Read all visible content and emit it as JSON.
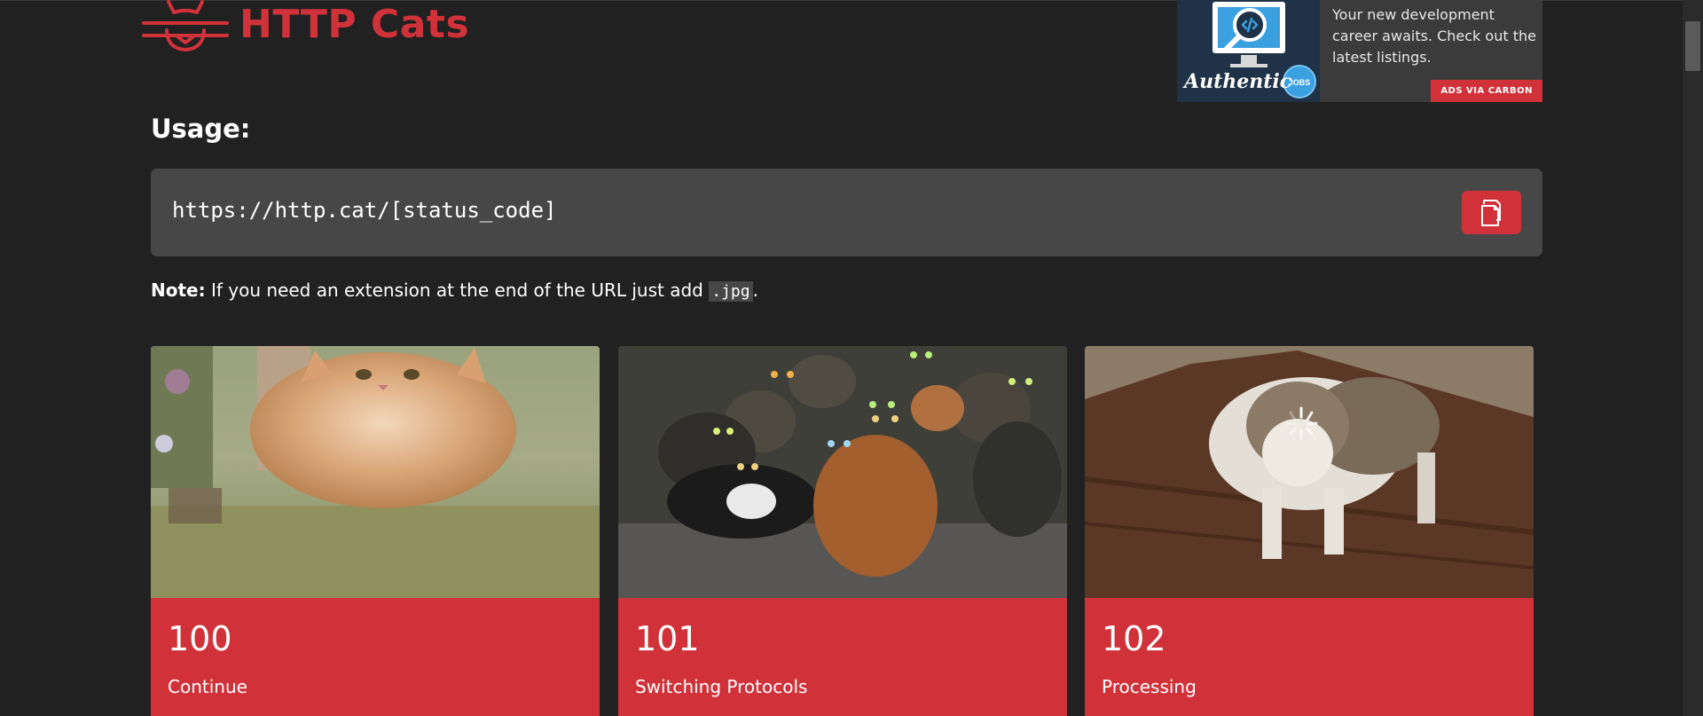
{
  "header": {
    "logo_text": "HTTP Cats"
  },
  "ad": {
    "text": "Your new development career awaits. Check out the latest listings.",
    "badge": "ADS VIA CARBON",
    "image_wordmark": "Authentic",
    "image_badge": "JOBS"
  },
  "usage": {
    "title": "Usage:",
    "url": "https://http.cat/[status_code]",
    "copy_icon": "copy-icon"
  },
  "note": {
    "label": "Note:",
    "text_before": " If you need an extension at the end of the URL just add ",
    "code": ".jpg",
    "text_after": "."
  },
  "cards": [
    {
      "code": "100",
      "title": "Continue"
    },
    {
      "code": "101",
      "title": "Switching Protocols"
    },
    {
      "code": "102",
      "title": "Processing"
    }
  ],
  "colors": {
    "background": "#212121",
    "accent": "#d1323a",
    "code_box": "#474747"
  }
}
